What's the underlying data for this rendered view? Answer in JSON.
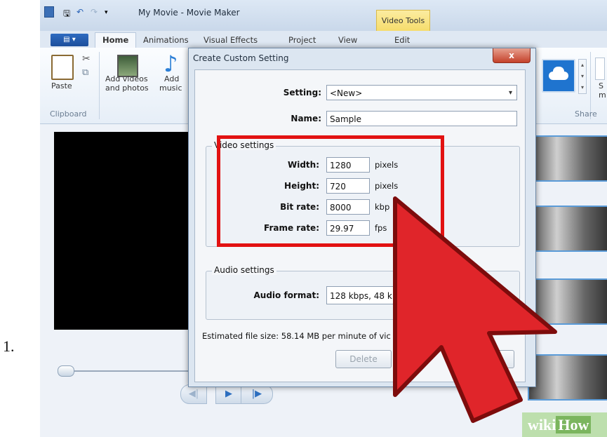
{
  "step_number": "1.",
  "window": {
    "title": "My Movie - Movie Maker",
    "contextual_group": "Video Tools",
    "tabs": [
      "Home",
      "Animations",
      "Visual Effects",
      "Project",
      "View",
      "Edit"
    ],
    "active_tab": "Home"
  },
  "ribbon": {
    "paste": "Paste",
    "add_videos": [
      "Add videos",
      "and photos"
    ],
    "add_music": [
      "Add",
      "music"
    ],
    "clipboard_group": "Clipboard",
    "share_group": "Share",
    "partial_1": "S",
    "partial_2": "m"
  },
  "dialog": {
    "title": "Create Custom Setting",
    "close_glyph": "x",
    "setting_label": "Setting:",
    "setting_value": "<New>",
    "name_label": "Name:",
    "name_value": "Sample",
    "video_settings": {
      "legend": "Video settings",
      "width_label": "Width:",
      "width_value": "1280",
      "width_unit": "pixels",
      "height_label": "Height:",
      "height_value": "720",
      "height_unit": "pixels",
      "bitrate_label": "Bit rate:",
      "bitrate_value": "8000",
      "bitrate_unit": "kbp",
      "framerate_label": "Frame rate:",
      "framerate_value": "29.97",
      "framerate_unit": "fps"
    },
    "audio_settings": {
      "legend": "Audio settings",
      "format_label": "Audio format:",
      "format_value": "128 kbps, 48 kH"
    },
    "estimate": "Estimated file size: 58.14 MB per minute of vic",
    "delete_button": "Delete"
  },
  "icons": [
    "app-icon",
    "save-icon",
    "undo-icon",
    "redo-icon",
    "qa-dropdown-icon",
    "paste-icon",
    "cut-icon",
    "copy-icon",
    "add-videos-icon",
    "music-note-icon",
    "onedrive-cloud-icon",
    "close-icon",
    "dropdown-arrow-icon",
    "prev-frame-icon",
    "play-icon",
    "next-frame-icon"
  ],
  "playback": {
    "prev": "◀|",
    "play": "▶",
    "next": "|▶"
  },
  "watermark": {
    "wiki": "wiki",
    "how": "How"
  },
  "colors": {
    "highlight_box": "#e21212",
    "arrow": "#e0252a",
    "dialog_close": "#c4412a",
    "video_tools": "#f6dc6a"
  }
}
